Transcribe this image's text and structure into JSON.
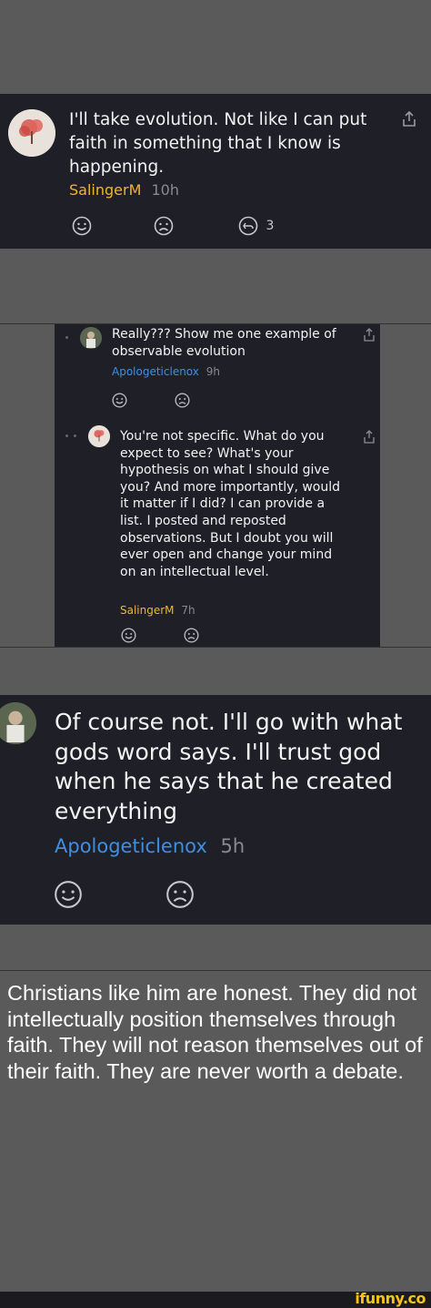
{
  "comment1": {
    "text": "I'll take evolution. Not like I can put faith in something that I know is happening.",
    "username": "SalingerM",
    "time": "10h",
    "reply_count": "3"
  },
  "thread": {
    "reply1": {
      "text": "Really??? Show me one example of observable evolution",
      "username": "Apologeticlenox",
      "time": "9h"
    },
    "reply2": {
      "text": "You're not specific. What do you expect to see? What's your hypothesis on what I should give you? And more importantly, would it matter if I did? I can provide a list. I posted and reposted observations. But I doubt you will ever open and change your mind on an intellectual level.",
      "username": "SalingerM",
      "time": "7h"
    }
  },
  "comment3": {
    "text": "Of course not. I'll go with what gods word says. I'll trust god when he says that he created everything",
    "username": "Apologeticlenox",
    "time": "5h"
  },
  "caption": {
    "text": "Christians like him are honest. They did not intellectually position themselves through faith. They will not reason themselves out of their faith. They are never worth a debate."
  },
  "watermark": "ifunny.co",
  "colors": {
    "panel_bg": "#1e1f27",
    "page_bg": "#5a5a5a",
    "username_orange": "#f1b52e",
    "username_blue": "#3d8fe6"
  },
  "icons": [
    "share-icon",
    "smile-icon",
    "frown-icon",
    "reply-icon"
  ]
}
